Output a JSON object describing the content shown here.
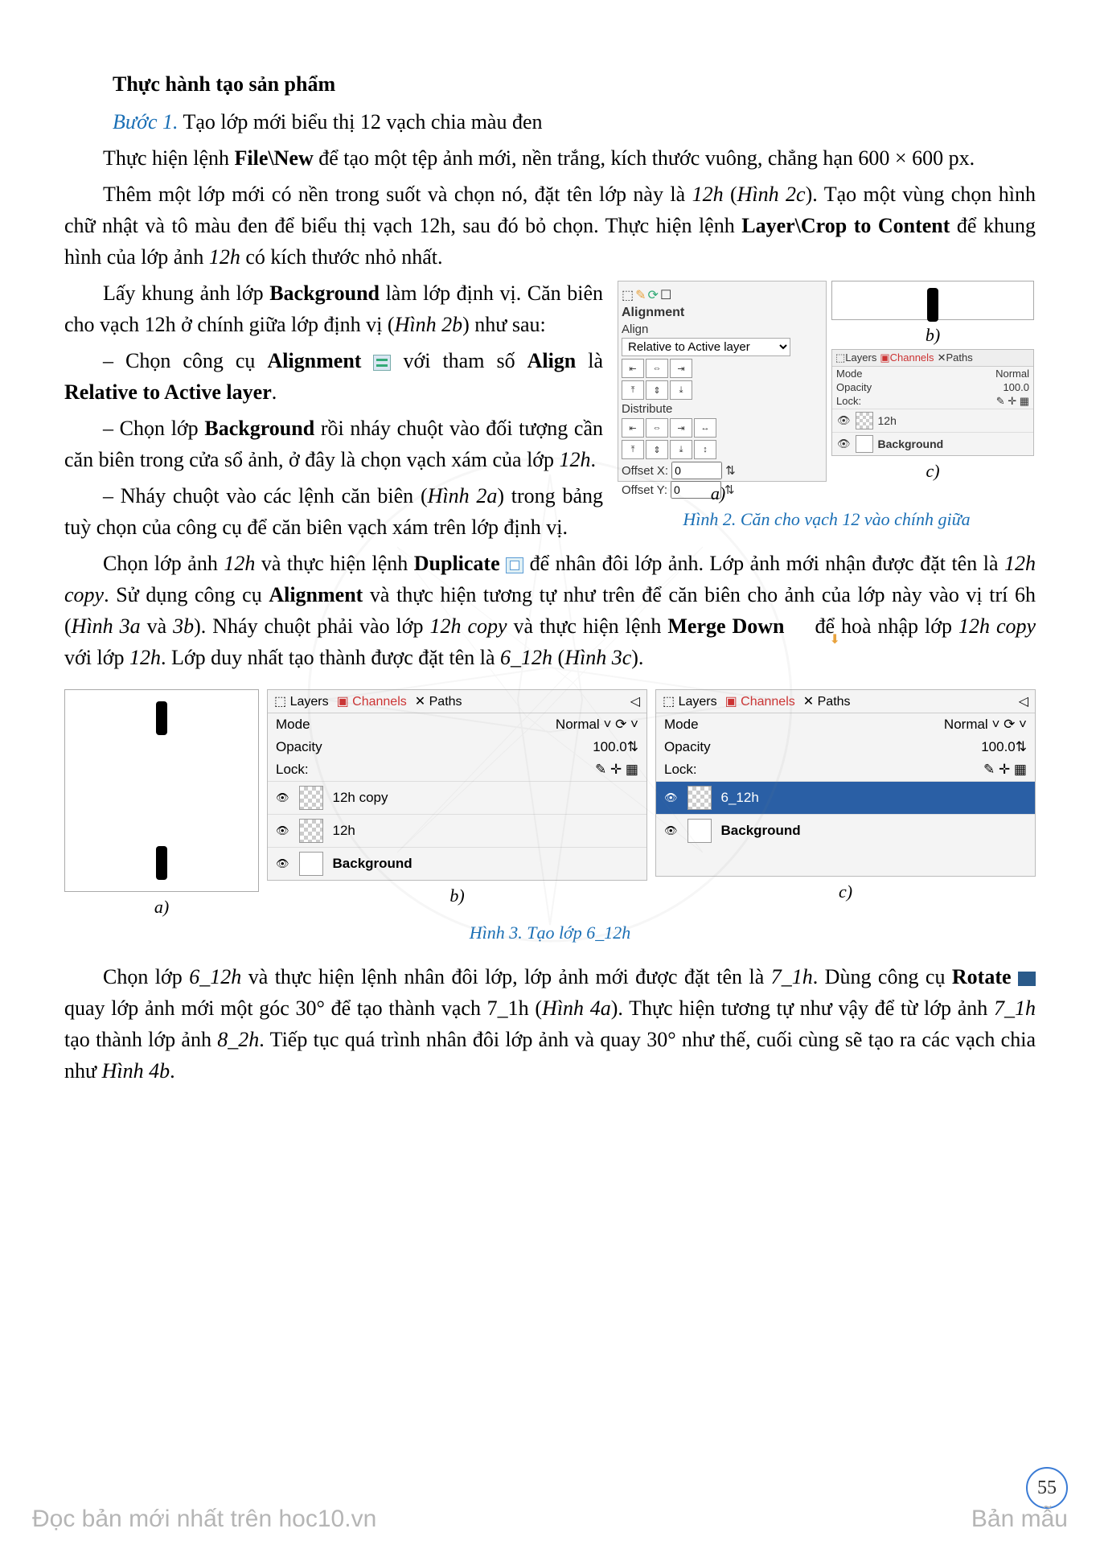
{
  "title": "Thực hành tạo sản phẩm",
  "step1": {
    "label": "Bước 1.",
    "text": " Tạo lớp mới biểu thị 12 vạch chia màu đen"
  },
  "p1": {
    "pre": "Thực hiện lệnh ",
    "cmd": "File\\New",
    "post": " để tạo một tệp ảnh mới, nền trắng, kích thước vuông, chẳng hạn 600 × 600 px."
  },
  "p2": {
    "a": "Thêm một lớp mới có nền trong suốt và chọn nó, đặt tên lớp này là ",
    "b": "12h",
    "c": " (",
    "d": "Hình 2c",
    "e": "). Tạo một vùng chọn hình chữ nhật và tô màu đen để biểu thị vạch 12h, sau đó bỏ chọn. Thực hiện lệnh ",
    "f": "Layer\\Crop to Content",
    "g": " để khung hình của lớp ảnh ",
    "h": "12h",
    "i": " có kích thước nhỏ nhất."
  },
  "p3": {
    "a": "Lấy khung ảnh lớp ",
    "b": "Background",
    "c": " làm lớp định vị. Căn biên cho vạch 12h ở chính giữa lớp định vị (",
    "d": "Hình 2b",
    "e": ") như sau:"
  },
  "li1": {
    "a": "– Chọn công cụ ",
    "b": "Alignment",
    "c": " với tham số ",
    "d": "Align",
    "e": " là ",
    "f": "Relative to Active layer",
    "g": "."
  },
  "li2": {
    "a": "– Chọn lớp ",
    "b": "Background",
    "c": " rồi nháy chuột vào đối tượng cần căn biên trong cửa sổ ảnh, ở đây là chọn vạch xám của lớp ",
    "d": "12h",
    "e": "."
  },
  "li3": {
    "a": "– Nháy chuột vào các lệnh căn biên (",
    "b": "Hình 2a",
    "c": ") trong bảng tuỳ chọn của công cụ để căn biên vạch xám trên lớp định vị."
  },
  "fig2": {
    "alignment_hdr": "Alignment",
    "align_sub": "Align",
    "dropdown": "Relative to Active layer",
    "distribute": "Distribute",
    "offset_x_label": "Offset X:",
    "offset_x_val": "0",
    "offset_y_label": "Offset Y:",
    "offset_y_val": "0",
    "a": "a)",
    "b": "b)",
    "c": "c)",
    "layers_tab": "Layers",
    "channels_tab": "Channels",
    "paths_tab": "Paths",
    "mode_label": "Mode",
    "mode_val": "Normal",
    "opacity_label": "Opacity",
    "opacity_val": "100.0",
    "lock_label": "Lock:",
    "layer1": "12h",
    "layer2": "Background",
    "caption": "Hình 2. Căn cho vạch 12 vào chính giữa"
  },
  "p4": {
    "a": "Chọn lớp ảnh ",
    "b": "12h",
    "c": " và thực hiện lệnh ",
    "d": "Duplicate",
    "e": " để nhân đôi lớp ảnh. Lớp ảnh mới nhận được đặt tên là ",
    "f": "12h copy",
    "g": ". Sử dụng công cụ ",
    "h": "Alignment",
    "i": " và thực hiện tương tự như trên để căn biên cho ảnh của lớp này vào vị trí 6h (",
    "j": "Hình 3a",
    "k": " và ",
    "l": "3b",
    "m": "). Nháy chuột phải vào lớp ",
    "n": "12h copy",
    "o": " và thực hiện lệnh ",
    "p": "Merge Down",
    "q": " để hoà nhập lớp ",
    "r": "12h copy",
    "s": " với lớp ",
    "t": "12h",
    "u": ". Lớp duy nhất tạo thành được đặt tên là ",
    "v": "6_12h",
    "w": " (",
    "x": "Hình 3c",
    "y": ")."
  },
  "fig3": {
    "layers_tab": "Layers",
    "channels_tab": "Channels",
    "paths_tab": "Paths",
    "mode_label": "Mode",
    "mode_val": "Normal",
    "opacity_label": "Opacity",
    "opacity_val": "100.0",
    "lock_label": "Lock:",
    "b_layer1": "12h copy",
    "b_layer2": "12h",
    "b_layer3": "Background",
    "c_layer1": "6_12h",
    "c_layer2": "Background",
    "a": "a)",
    "b": "b)",
    "c": "c)",
    "caption": "Hình 3. Tạo lớp 6_12h"
  },
  "p5": {
    "a": "Chọn lớp ",
    "b": "6_12h",
    "c": " và thực hiện lệnh nhân đôi lớp, lớp ảnh mới được đặt tên là ",
    "d": "7_1h",
    "e": ". Dùng công cụ ",
    "f": "Rotate",
    "g": " quay lớp ảnh mới một góc 30° để tạo thành vạch 7_1h (",
    "h": "Hình 4a",
    "i": "). Thực hiện tương tự như vậy để từ lớp ảnh ",
    "j": "7_1h",
    "k": " tạo thành lớp ảnh ",
    "l": "8_2h",
    "m": ". Tiếp tục quá trình nhân đôi lớp ảnh và quay 30° như thế, cuối cùng sẽ tạo ra các vạch chia như ",
    "n": "Hình 4b",
    "o": "."
  },
  "pagenum": "55",
  "footer_left": "Đọc bản mới nhất trên hoc10.vn",
  "footer_right": "Bản mẫu"
}
